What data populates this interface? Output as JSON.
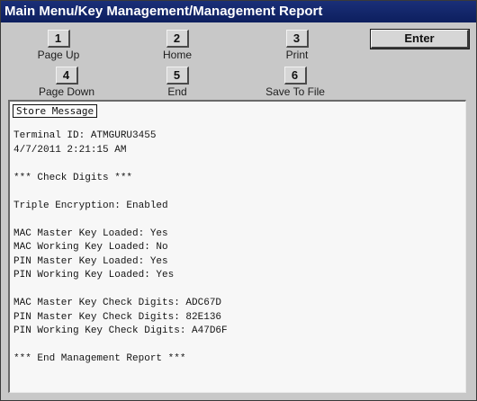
{
  "title": "Main Menu/Key Management/Management Report",
  "keys": [
    {
      "number": "1",
      "label": "Page Up"
    },
    {
      "number": "2",
      "label": "Home"
    },
    {
      "number": "3",
      "label": "Print"
    },
    {
      "number": "4",
      "label": "Page Down"
    },
    {
      "number": "5",
      "label": "End"
    },
    {
      "number": "6",
      "label": "Save To File"
    }
  ],
  "enter_label": "Enter",
  "report": {
    "header": "Store Message",
    "lines": [
      "",
      "Terminal ID: ATMGURU3455",
      "4/7/2011 2:21:15 AM",
      "",
      "*** Check Digits ***",
      "",
      "Triple Encryption: Enabled",
      "",
      "MAC Master Key Loaded: Yes",
      "MAC Working Key Loaded: No",
      "PIN Master Key Loaded: Yes",
      "PIN Working Key Loaded: Yes",
      "",
      "MAC Master Key Check Digits: ADC67D",
      "PIN Master Key Check Digits: 82E136",
      "PIN Working Key Check Digits: A47D6F",
      "",
      "*** End Management Report ***"
    ]
  }
}
